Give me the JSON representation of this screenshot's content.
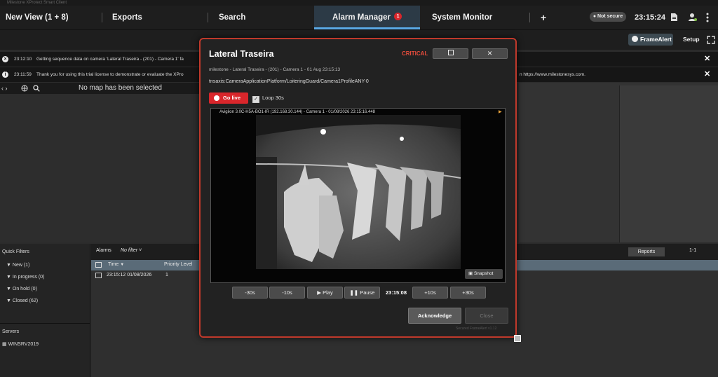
{
  "window": {
    "title": "Milestone XProtect Smart Client"
  },
  "tabs": [
    {
      "label": "New View (1 + 8)"
    },
    {
      "label": "Exports"
    },
    {
      "label": "Search"
    },
    {
      "label": "Alarm Manager",
      "badge": "1"
    },
    {
      "label": "System Monitor"
    },
    {
      "label": "+"
    }
  ],
  "header": {
    "security": "Not secure",
    "clock": "23:15:24"
  },
  "toolbar": {
    "framealert": "FrameAlert",
    "setup": "Setup"
  },
  "messages": [
    {
      "time": "23:12:10",
      "text": "Getting sequence data on camera 'Lateral Traseira - (201) - Camera 1' fa",
      "tail": ""
    },
    {
      "time": "23:11:59",
      "text": "Thank you for using this trial license to demonstrate or evaluate the XPro",
      "tail": "n https://www.milestonesys.com."
    }
  ],
  "map": {
    "placeholder": "No map has been selected"
  },
  "quick_filters": {
    "title": "Quick Filters",
    "items": [
      "New (1)",
      "In progress (0)",
      "On hold (0)",
      "Closed (62)"
    ],
    "servers_title": "Servers",
    "server": "WINSRV2019"
  },
  "alarms": {
    "label": "Alarms",
    "filter": "No filter",
    "reports": "Reports",
    "range": "1-1",
    "columns": [
      "Time",
      "Priority Level"
    ],
    "rows": [
      {
        "time": "23:15:12 01/08/2026",
        "priority": "1"
      }
    ]
  },
  "dialog": {
    "title": "Lateral Traseira",
    "severity": "CRITICAL",
    "subtitle": "milestone - Lateral Traseira - (201) - Camera 1 - 01 Aug 23:15:13",
    "event": "tnsaxis:CameraApplicationPlatform/LoiteringGuard/Camera1ProfileANY-0",
    "go_live": "Go live",
    "loop": "Loop 30s",
    "video_overlay": "Avigilon 3.0C-H5A-BO1-IR (192.168.30.144) - Camera 1 - 01/08/2026 23:15:16.448",
    "snapshot": "Snapshot",
    "playback": {
      "back30": "-30s",
      "back10": "-10s",
      "play": "Play",
      "pause": "Pause",
      "time": "23:15:08",
      "fwd10": "+10s",
      "fwd30": "+30s"
    },
    "acknowledge": "Acknowledge",
    "close": "Close",
    "footer": "Secured FrameAlert v1.12"
  },
  "colors": {
    "accent": "#5aa9e6",
    "critical": "#e74c3c",
    "alarm_red": "#d9262b"
  }
}
